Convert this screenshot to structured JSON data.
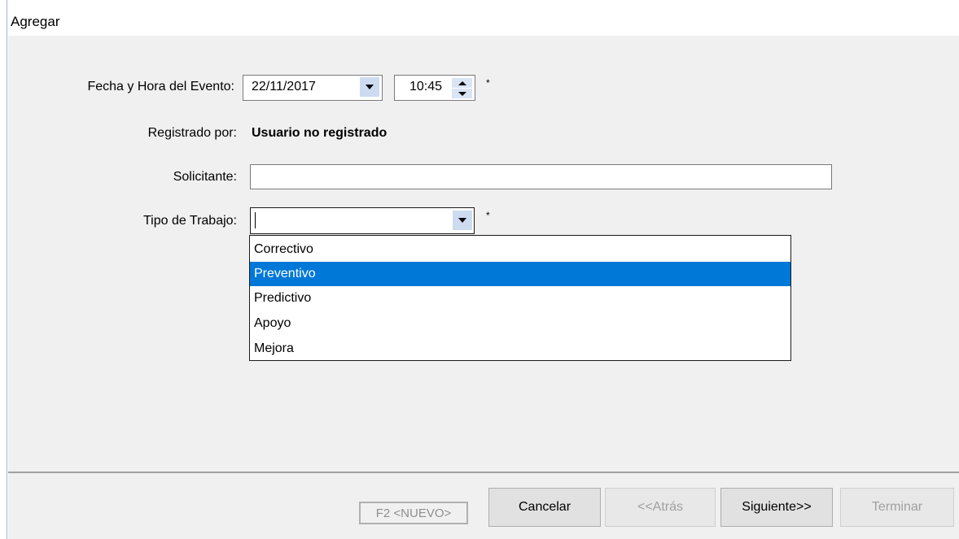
{
  "window": {
    "title": "Agregar"
  },
  "form": {
    "fecha_label": "Fecha y Hora del Evento:",
    "fecha_value": "22/11/2017",
    "hora_value": "10:45",
    "fecha_required": "*",
    "registrado_label": "Registrado por:",
    "registrado_value": "Usuario no registrado",
    "solicitante_label": "Solicitante:",
    "solicitante_value": "",
    "tipo_label": "Tipo de Trabajo:",
    "tipo_value": "",
    "tipo_required": "*"
  },
  "tipo_dropdown": {
    "options": [
      "Correctivo",
      "Preventivo",
      "Predictivo",
      "Apoyo",
      "Mejora"
    ],
    "highlighted": "Preventivo"
  },
  "footer": {
    "nuevo_label": "F2 <NUEVO>",
    "cancel_label": "Cancelar",
    "back_label": "<<Atrás",
    "next_label": "Siguiente>>",
    "finish_label": "Terminar"
  },
  "colors": {
    "selection": "#0078d7",
    "dropdown_button": "#cddbf0",
    "panel_background": "#f0f0f0"
  }
}
